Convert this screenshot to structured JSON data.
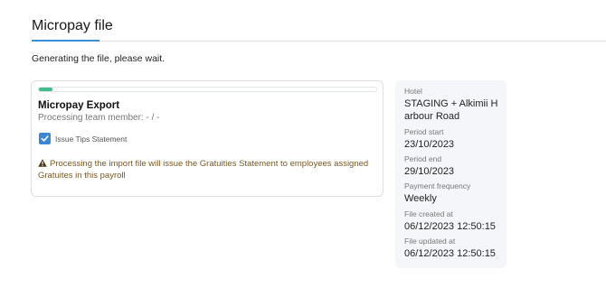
{
  "page": {
    "title": "Micropay file",
    "status": "Generating the file, please wait."
  },
  "export": {
    "title": "Micropay Export",
    "team_member": "Processing team member: - / -",
    "progress_percent": 4,
    "progress_color": "#3fbf8e",
    "checkbox_label": "Issue Tips Statement",
    "checkbox_checked": true,
    "warning_icon": "warning-triangle-icon",
    "warning_text": "Processing the import file will issue the Gratuities Statement to employees assigned Gratuites in this payroll"
  },
  "info": {
    "hotel_label": "Hotel",
    "hotel_value": "STAGING + Alkimii Harbour Road",
    "period_start_label": "Period start",
    "period_start_value": "23/10/2023",
    "period_end_label": "Period end",
    "period_end_value": "29/10/2023",
    "frequency_label": "Payment frequency",
    "frequency_value": "Weekly",
    "created_label": "File created at",
    "created_value": "06/12/2023 12:50:15",
    "updated_label": "File updated at",
    "updated_value": "06/12/2023 12:50:15"
  },
  "colors": {
    "accent": "#3a86d8",
    "warning_text": "#7a5820",
    "panel_bg": "#f4f6f9"
  }
}
